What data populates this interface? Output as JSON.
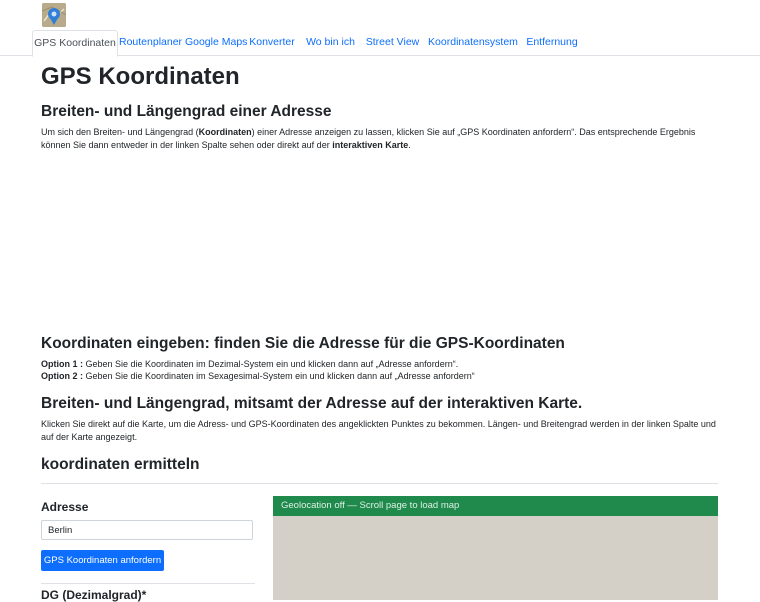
{
  "nav": {
    "items": [
      {
        "label": "GPS Koordinaten",
        "active": true
      },
      {
        "label": "Routenplaner Google Maps",
        "active": false
      },
      {
        "label": "Konverter",
        "active": false
      },
      {
        "label": "Wo bin ich",
        "active": false
      },
      {
        "label": "Street View",
        "active": false
      },
      {
        "label": "Koordinatensystem",
        "active": false
      },
      {
        "label": "Entfernung",
        "active": false
      }
    ]
  },
  "page": {
    "title": "GPS Koordinaten"
  },
  "section1": {
    "heading": "Breiten- und Längengrad einer Adresse",
    "text_part1": "Um sich den Breiten- und Längengrad (",
    "text_bold1": "Koordinaten",
    "text_part2": ") einer Adresse anzeigen zu lassen, klicken Sie auf „GPS Koordinaten anfordern“. Das entsprechende Ergebnis können Sie dann entweder in der linken Spalte sehen oder direkt auf der ",
    "text_bold2": "interaktiven Karte",
    "text_part3": "."
  },
  "section2": {
    "heading": "Koordinaten eingeben: finden Sie die Adresse für die GPS-Koordinaten",
    "option1_label": "Option 1 :",
    "option1_text": " Geben Sie die Koordinaten im Dezimal-System ein und klicken dann auf „Adresse anfordern“.",
    "option2_label": "Option 2 :",
    "option2_text": " Geben Sie die Koordinaten im Sexagesimal-System ein und klicken dann auf „Adresse anfordern“"
  },
  "section3": {
    "heading": "Breiten- und Längengrad, mitsamt der Adresse auf der interaktiven Karte.",
    "text": "Klicken Sie direkt auf die Karte, um die Adress- und GPS-Koordinaten des angeklickten Punktes zu bekommen. Längen- und Breitengrad werden in der linken Spalte und auf der Karte angezeigt."
  },
  "section4": {
    "heading": "koordinaten ermitteln"
  },
  "form": {
    "address_label": "Adresse",
    "address_value": "Berlin",
    "submit_label": "GPS Koordinaten anfordern",
    "dg_label": "DG (Dezimalgrad)*"
  },
  "map": {
    "status_text": "Geolocation off — Scroll page to load map",
    "bar_color": "#1f8a4c",
    "background_color": "#d4d0c8"
  }
}
